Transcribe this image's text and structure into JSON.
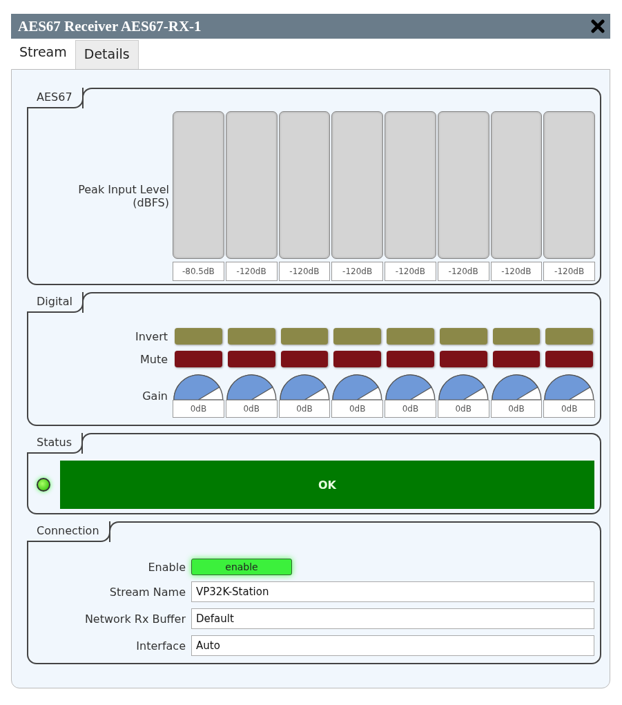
{
  "window": {
    "title": "AES67 Receiver AES67-RX-1"
  },
  "tabs": [
    {
      "label": "Stream",
      "selected": true
    },
    {
      "label": "Details",
      "selected": false
    }
  ],
  "aes67": {
    "title": "AES67",
    "meter_label": "Peak Input Level (dBFS)",
    "channels": [
      {
        "reading": "-80.5dB"
      },
      {
        "reading": "-120dB"
      },
      {
        "reading": "-120dB"
      },
      {
        "reading": "-120dB"
      },
      {
        "reading": "-120dB"
      },
      {
        "reading": "-120dB"
      },
      {
        "reading": "-120dB"
      },
      {
        "reading": "-120dB"
      }
    ]
  },
  "digital": {
    "title": "Digital",
    "invert_label": "Invert",
    "mute_label": "Mute",
    "gain_label": "Gain",
    "channels": [
      {
        "invert": {
          "on": false
        },
        "mute": {
          "on": false
        },
        "gain": {
          "level": 0.83,
          "reading": "0dB"
        }
      },
      {
        "invert": {
          "on": false
        },
        "mute": {
          "on": false
        },
        "gain": {
          "level": 0.83,
          "reading": "0dB"
        }
      },
      {
        "invert": {
          "on": false
        },
        "mute": {
          "on": false
        },
        "gain": {
          "level": 0.83,
          "reading": "0dB"
        }
      },
      {
        "invert": {
          "on": false
        },
        "mute": {
          "on": false
        },
        "gain": {
          "level": 0.83,
          "reading": "0dB"
        }
      },
      {
        "invert": {
          "on": false
        },
        "mute": {
          "on": false
        },
        "gain": {
          "level": 0.83,
          "reading": "0dB"
        }
      },
      {
        "invert": {
          "on": false
        },
        "mute": {
          "on": false
        },
        "gain": {
          "level": 0.83,
          "reading": "0dB"
        }
      },
      {
        "invert": {
          "on": false
        },
        "mute": {
          "on": false
        },
        "gain": {
          "level": 0.83,
          "reading": "0dB"
        }
      },
      {
        "invert": {
          "on": false
        },
        "mute": {
          "on": false
        },
        "gain": {
          "level": 0.83,
          "reading": "0dB"
        }
      }
    ]
  },
  "status": {
    "title": "Status",
    "led": {
      "on": true
    },
    "text": "OK"
  },
  "connection": {
    "title": "Connection",
    "fields": [
      {
        "kind": "toggle",
        "label": "Enable",
        "value": "enable",
        "on": true
      },
      {
        "kind": "text",
        "label": "Stream Name",
        "value": "VP32K-Station"
      },
      {
        "kind": "text",
        "label": "Network Rx Buffer",
        "value": "Default"
      },
      {
        "kind": "text",
        "label": "Interface",
        "value": "Auto"
      }
    ]
  }
}
